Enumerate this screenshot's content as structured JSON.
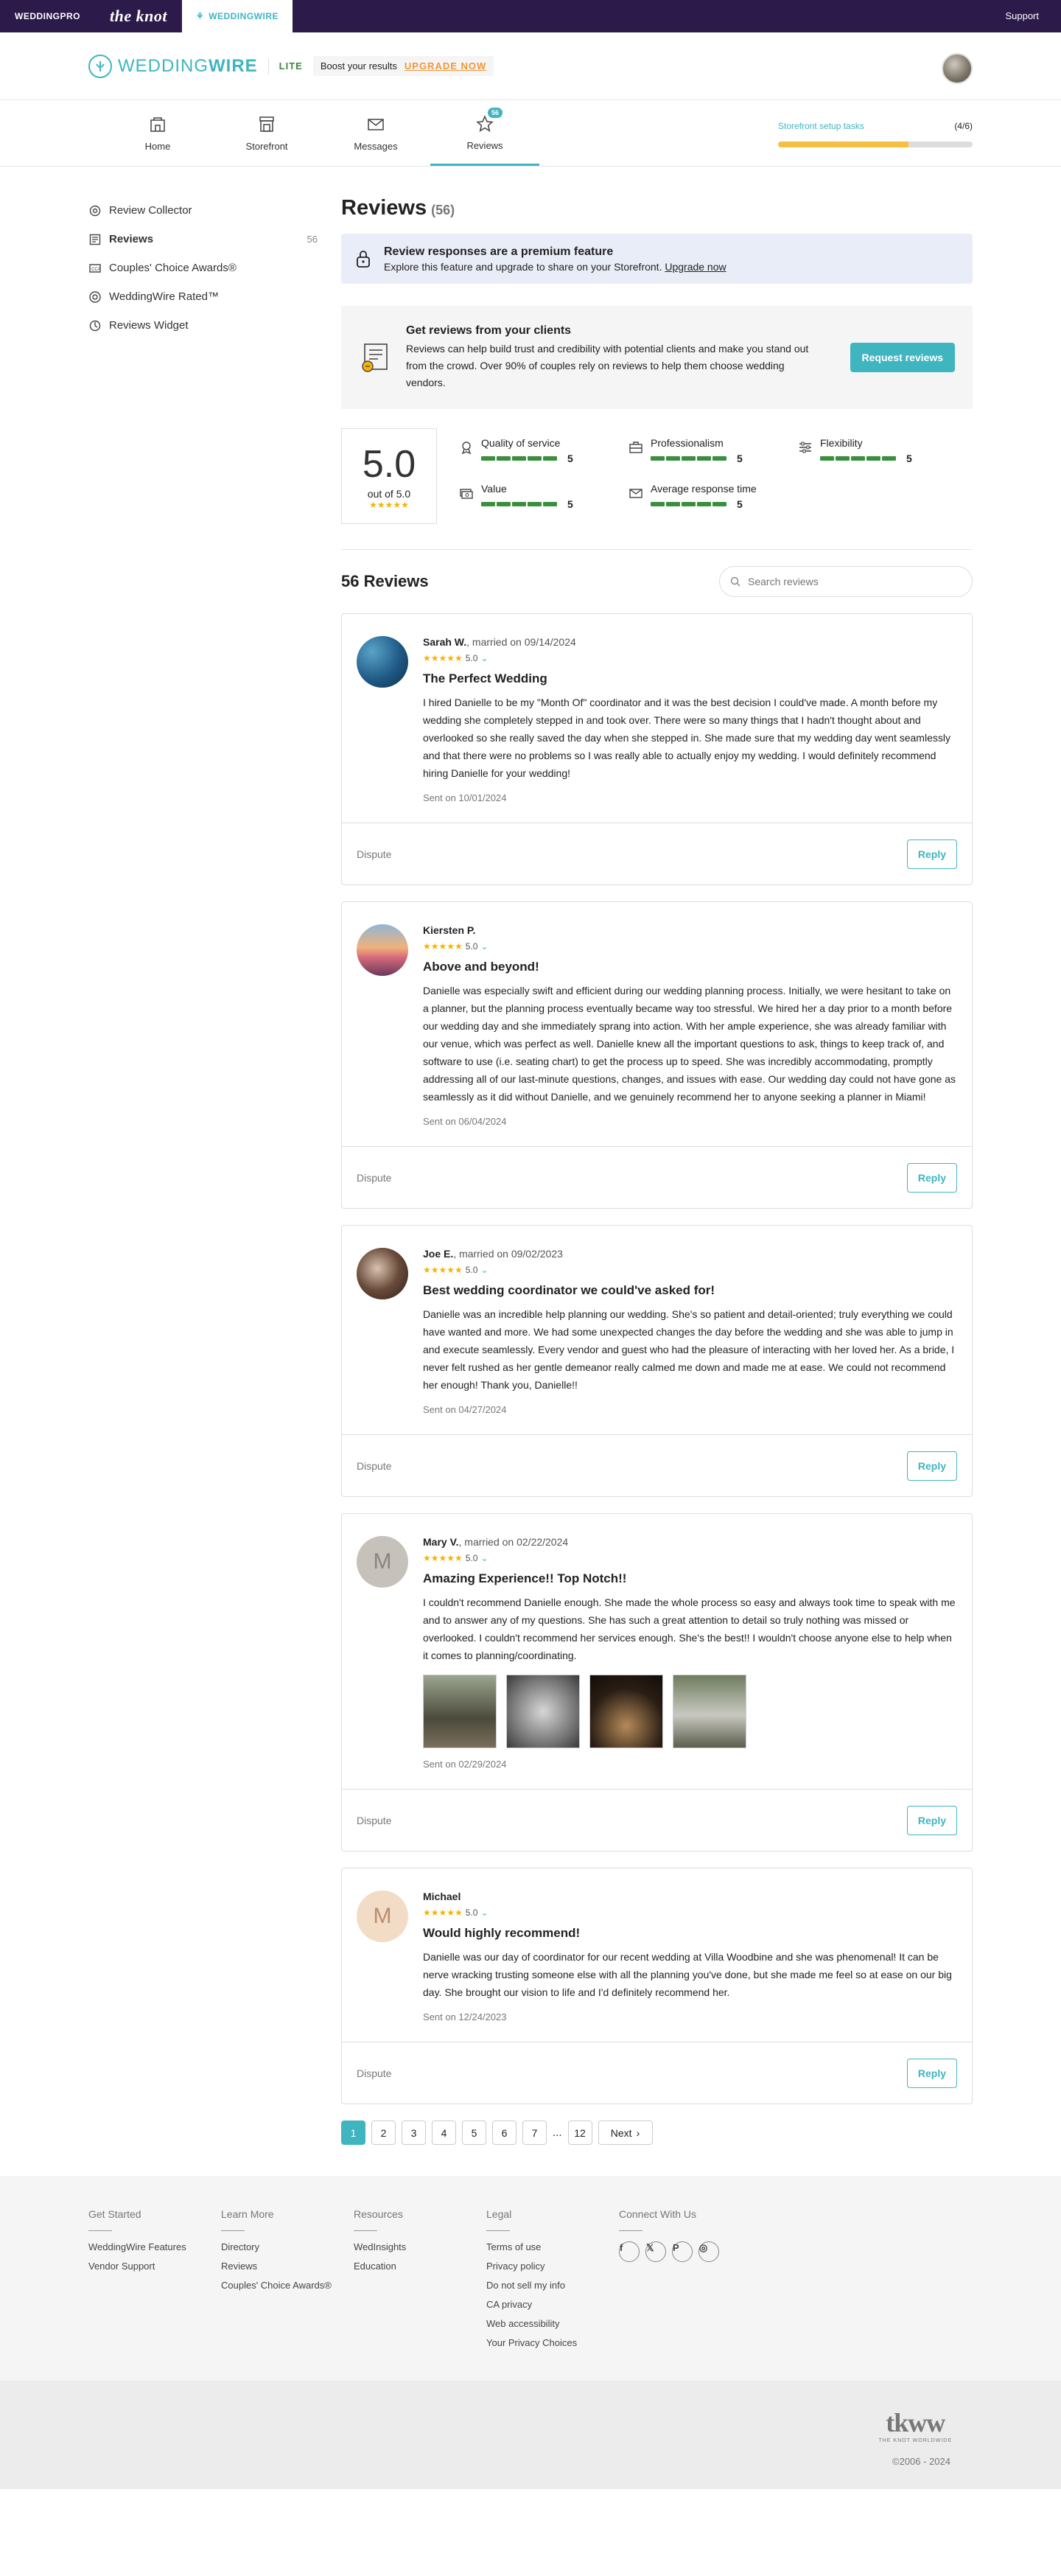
{
  "topbar": {
    "brand1": "WEDDINGPRO",
    "brand2": "the knot",
    "brand3": "WEDDINGWIRE",
    "support": "Support"
  },
  "header": {
    "logo_light": "WEDDING",
    "logo_bold": "WIRE",
    "plan": "LITE",
    "boost_text": "Boost your results",
    "upgrade": "UPGRADE NOW"
  },
  "nav": {
    "items": [
      {
        "label": "Home",
        "icon": "home-icon"
      },
      {
        "label": "Storefront",
        "icon": "storefront-icon"
      },
      {
        "label": "Messages",
        "icon": "messages-icon"
      },
      {
        "label": "Reviews",
        "icon": "star-icon",
        "badge": "56"
      }
    ],
    "setup_label": "Storefront setup tasks",
    "setup_count": "(4/6)",
    "setup_progress": 0.67
  },
  "sidebar": {
    "items": [
      {
        "label": "Review Collector",
        "icon": "gear-icon"
      },
      {
        "label": "Reviews",
        "icon": "review-icon",
        "count": "56"
      },
      {
        "label": "Couples' Choice Awards®",
        "icon": "award-icon"
      },
      {
        "label": "WeddingWire Rated™",
        "icon": "rated-icon"
      },
      {
        "label": "Reviews Widget",
        "icon": "widget-icon"
      }
    ]
  },
  "page": {
    "title": "Reviews",
    "count": "(56)"
  },
  "premium": {
    "title": "Review responses are a premium feature",
    "text": "Explore this feature and upgrade to share on your Storefront.",
    "link": "Upgrade now"
  },
  "get_reviews": {
    "title": "Get reviews from your clients",
    "text": "Reviews can help build trust and credibility with potential clients and make you stand out from the crowd. Over 90% of couples rely on reviews to help them choose wedding vendors.",
    "button": "Request reviews"
  },
  "rating": {
    "score": "5.0",
    "out_of": "out of 5.0",
    "stars": "★★★★★",
    "metrics": [
      {
        "label": "Quality of service",
        "value": "5",
        "icon": "ribbon-icon"
      },
      {
        "label": "Professionalism",
        "value": "5",
        "icon": "briefcase-icon"
      },
      {
        "label": "Flexibility",
        "value": "5",
        "icon": "sliders-icon"
      },
      {
        "label": "Value",
        "value": "5",
        "icon": "money-icon"
      },
      {
        "label": "Average response time",
        "value": "5",
        "icon": "mail-icon"
      }
    ]
  },
  "list": {
    "title": "56 Reviews",
    "search_placeholder": "Search reviews"
  },
  "reviews": [
    {
      "name": "Sarah W.",
      "married": ", married on 09/14/2024",
      "score": "5.0",
      "title": "The Perfect Wedding",
      "text": "I hired Danielle to be my \"Month Of\" coordinator and it was the best decision I could've made. A month before my wedding she completely stepped in and took over. There were so many things that I hadn't thought about and overlooked so she really saved the day when she stepped in. She made sure that my wedding day went seamlessly and that there were no problems so I was really able to actually enjoy my wedding. I would definitely recommend hiring Danielle for your wedding!",
      "sent": "Sent on 10/01/2024",
      "initial": ""
    },
    {
      "name": "Kiersten P.",
      "married": "",
      "score": "5.0",
      "title": "Above and beyond!",
      "text": "Danielle was especially swift and efficient during our wedding planning process. Initially, we were hesitant to take on a planner, but the planning process eventually became way too stressful. We hired her a day prior to a month before our wedding day and she immediately sprang into action. With her ample experience, she was already familiar with our venue, which was perfect as well. Danielle knew all the important questions to ask, things to keep track of, and software to use (i.e. seating chart) to get the process up to speed. She was incredibly accommodating, promptly addressing all of our last-minute questions, changes, and issues with ease. Our wedding day could not have gone as seamlessly as it did without Danielle, and we genuinely recommend her to anyone seeking a planner in Miami!",
      "sent": "Sent on 06/04/2024",
      "initial": ""
    },
    {
      "name": "Joe E.",
      "married": ", married on 09/02/2023",
      "score": "5.0",
      "title": "Best wedding coordinator we could've asked for!",
      "text": "Danielle was an incredible help planning our wedding. She's so patient and detail-oriented; truly everything we could have wanted and more. We had some unexpected changes the day before the wedding and she was able to jump in and execute seamlessly. Every vendor and guest who had the pleasure of interacting with her loved her. As a bride, I never felt rushed as her gentle demeanor really calmed me down and made me at ease. We could not recommend her enough! Thank you, Danielle!!",
      "sent": "Sent on 04/27/2024",
      "initial": ""
    },
    {
      "name": "Mary V.",
      "married": ", married on 02/22/2024",
      "score": "5.0",
      "title": "Amazing Experience!! Top Notch!!",
      "text": "I couldn't recommend Danielle enough. She made the whole process so easy and always took time to speak with me and to answer any of my questions. She has such a great attention to detail so truly nothing was missed or overlooked. I couldn't recommend her services enough. She's the best!! I wouldn't choose anyone else to help when it comes to planning/coordinating.",
      "sent": "Sent on 02/29/2024",
      "initial": "M"
    },
    {
      "name": "Michael",
      "married": "",
      "score": "5.0",
      "title": "Would highly recommend!",
      "text": "Danielle was our day of coordinator for our recent wedding at Villa Woodbine and she was phenomenal! It can be nerve wracking trusting someone else with all the planning you've done, but she made me feel so at ease on our big day. She brought our vision to life and I'd definitely recommend her.",
      "sent": "Sent on 12/24/2023",
      "initial": "M"
    }
  ],
  "review_actions": {
    "dispute": "Dispute",
    "reply": "Reply"
  },
  "pagination": {
    "pages": [
      "1",
      "2",
      "3",
      "4",
      "5",
      "6",
      "7"
    ],
    "ellipsis": "...",
    "last": "12",
    "next": "Next"
  },
  "footer": {
    "cols": [
      {
        "title": "Get Started",
        "links": [
          "WeddingWire Features",
          "Vendor Support"
        ]
      },
      {
        "title": "Learn More",
        "links": [
          "Directory",
          "Reviews",
          "Couples' Choice Awards®"
        ]
      },
      {
        "title": "Resources",
        "links": [
          "WedInsights",
          "Education"
        ]
      },
      {
        "title": "Legal",
        "links": [
          "Terms of use",
          "Privacy policy",
          "Do not sell my info",
          "CA privacy",
          "Web accessibility",
          "Your Privacy Choices"
        ]
      }
    ],
    "connect_title": "Connect With Us",
    "socials": [
      "facebook-icon",
      "x-icon",
      "pinterest-icon",
      "instagram-icon"
    ],
    "tkww": "tkww",
    "tkww_sub": "THE KNOT WORLDWIDE",
    "copyright": "©2006 - 2024"
  },
  "colors": {
    "accent": "#3fb5c0",
    "topbar": "#2c1a4a",
    "bars": "#3a8f3f",
    "stars": "#f5b400",
    "upgrade": "#f0973a"
  }
}
